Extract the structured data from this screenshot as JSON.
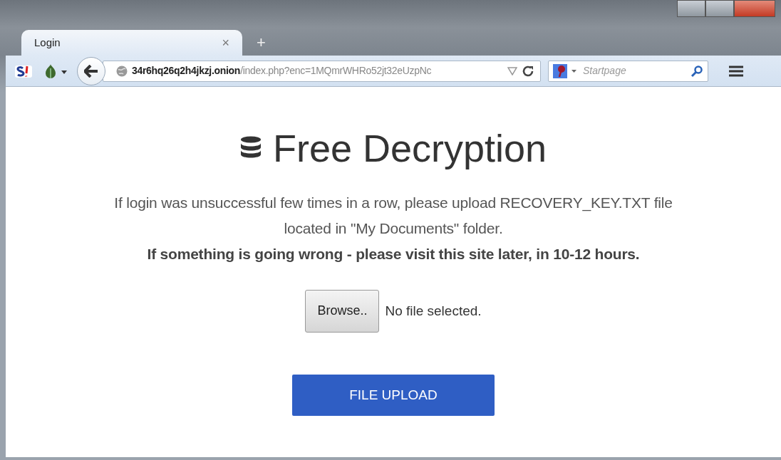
{
  "tabs": [
    {
      "label": "Login",
      "selected": true,
      "close": "×"
    }
  ],
  "new_tab": "+",
  "toolbar": {
    "url": "**34r6hq26q2h4jkzj.onion**/index.php?enc=1MQmrWHRo52jt32eUzpNc",
    "search": {
      "placeholder": "Startpage"
    }
  },
  "page": {
    "title": "Free Decryption",
    "message": "If login was unsuccessful few times in a row, please upload RECOVERY_KEY.TXT file located in \"My Documents\" folder.",
    "notice": "If something is going wrong - please visit this site later, in 10-12 hours.",
    "browse_button": "Browse..",
    "file_status": "No file selected.",
    "upload_button": "FILE UPLOAD"
  }
}
